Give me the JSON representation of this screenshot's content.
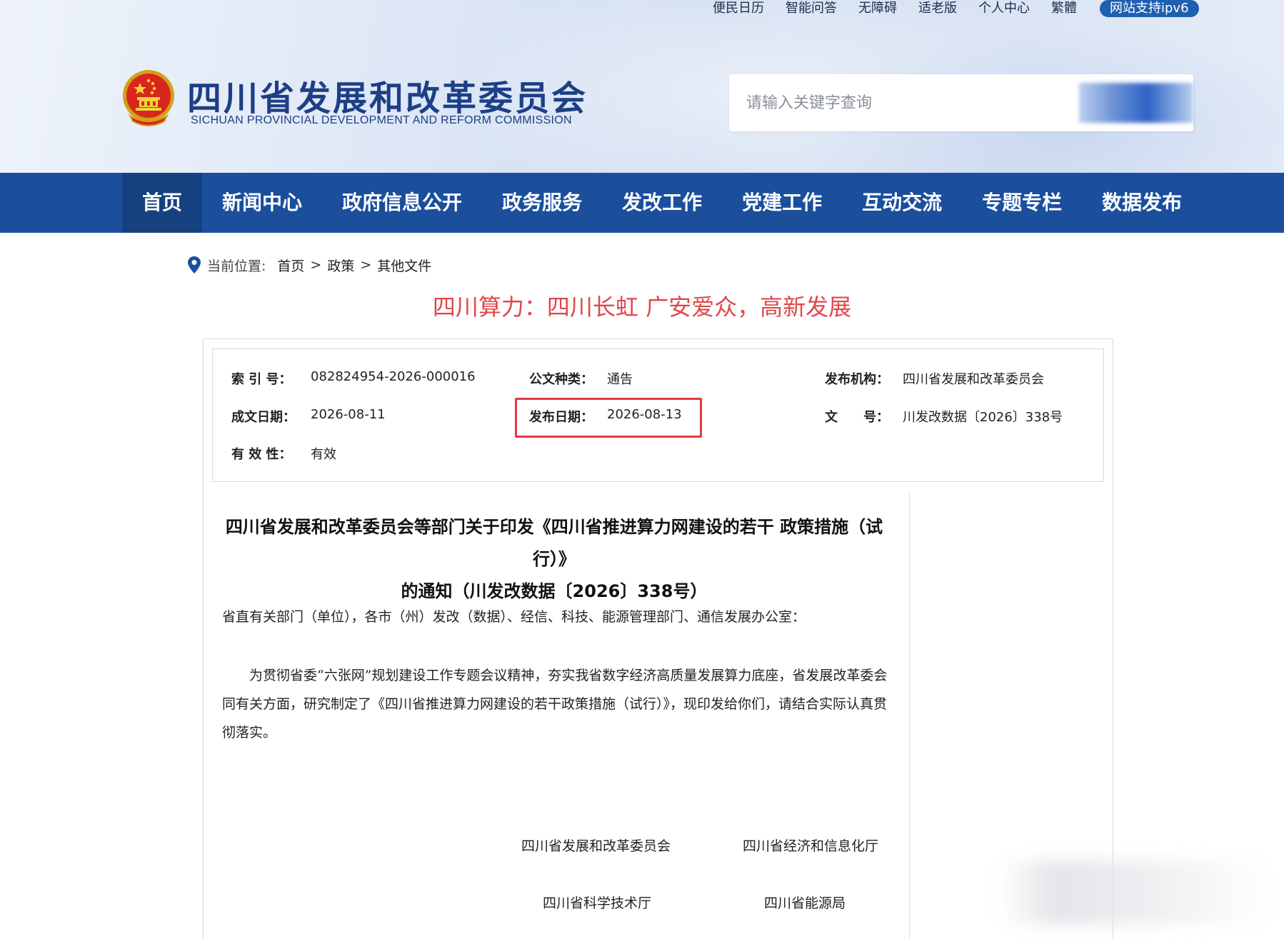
{
  "toplinks": {
    "items": [
      "便民日历",
      "智能问答",
      "无障碍",
      "适老版",
      "个人中心",
      "繁體"
    ],
    "ipv6": "网站支持ipv6"
  },
  "site": {
    "title": "四川省发展和改革委员会",
    "subtitle": "SICHUAN PROVINCIAL DEVELOPMENT AND REFORM COMMISSION"
  },
  "search": {
    "placeholder": "请输入关键字查询"
  },
  "nav": {
    "items": [
      "首页",
      "新闻中心",
      "政府信息公开",
      "政务服务",
      "发改工作",
      "党建工作",
      "互动交流",
      "专题专栏",
      "数据发布"
    ]
  },
  "breadcrumb": {
    "lead": "当前位置:",
    "items": [
      "首页",
      "政策",
      "其他文件"
    ],
    "separator": ">"
  },
  "page_title": "四川算力：四川长虹 广安爱众，高新发展",
  "meta": {
    "index_label": "索 引 号：",
    "index_value": "082824954-2026-000016",
    "category_label": "公文种类：",
    "category_value": "通告",
    "issuer_label": "发布机构：",
    "issuer_value": "四川省发展和改革委员会",
    "written_label": "成文日期：",
    "written_value": "2026-08-11",
    "publish_label": "发布日期：",
    "publish_value": "2026-08-13",
    "docno_label": "文　　号：",
    "docno_value": "川发改数据〔2026〕338号",
    "validity_label": "有 效 性：",
    "validity_value": "有效"
  },
  "document": {
    "heading_line1": "四川省发展和改革委员会等部门关于印发《四川省推进算力网建设的若干 政策措施（试行）》",
    "heading_line2": "的通知（川发改数据〔2026〕338号）",
    "recipients": "省直有关部门（单位），各市（州）发改（数据）、经信、科技、能源管理部门、通信发展办公室：",
    "body": "为贯彻省委“六张网”规划建设工作专题会议精神，夯实我省数字经济高质量发展算力底座，省发展改革委会同有关方面，研究制定了《四川省推进算力网建设的若干政策措施（试行）》，现印发给你们，请结合实际认真贯彻落实。",
    "signatures": [
      "四川省发展和改革委员会",
      "四川省经济和信息化厅",
      "四川省科学技术厅",
      "四川省能源局"
    ]
  },
  "colors": {
    "nav_bg": "#1b4f9c",
    "title_blue": "#1d3f86",
    "accent_red": "#e0474a",
    "highlight_red": "#e03a3e"
  }
}
